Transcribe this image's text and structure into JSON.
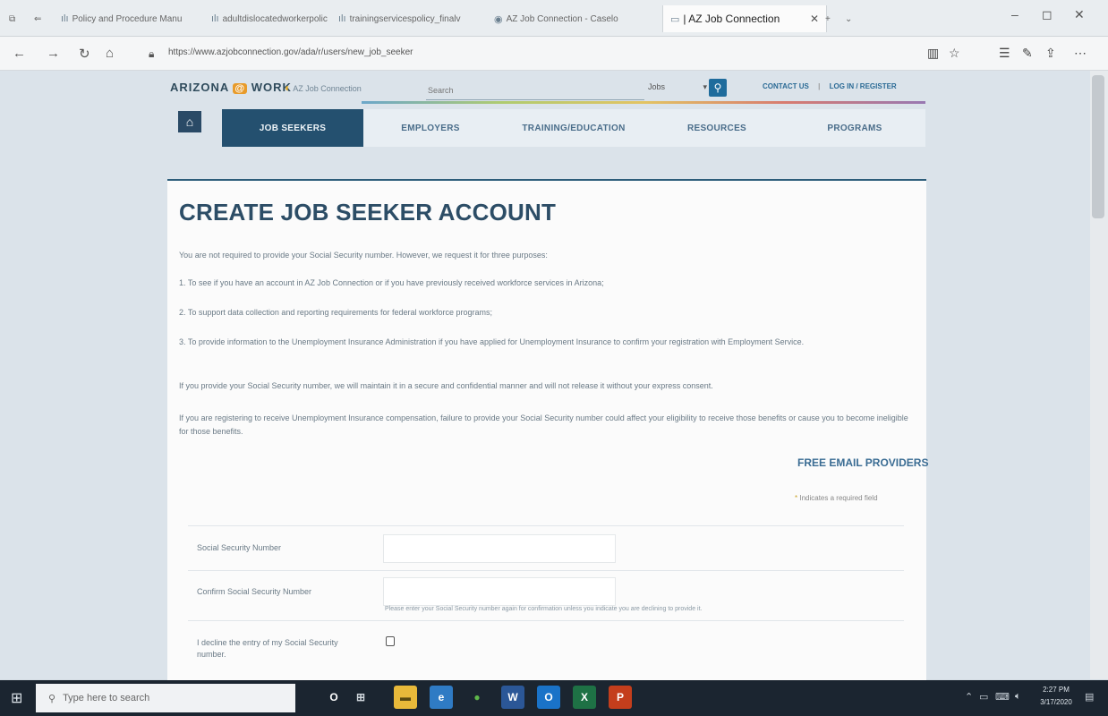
{
  "browser": {
    "tabs": [
      {
        "label": "Policy and Procedure Manu"
      },
      {
        "label": "adultdislocatedworkerpolicy"
      },
      {
        "label": "trainingservicespolicy_finalv"
      },
      {
        "label": "AZ Job Connection - Caselo"
      },
      {
        "label": "| AZ Job Connection",
        "active": true
      }
    ],
    "url": "https://www.azjobconnection.gov/ada/r/users/new_job_seeker",
    "window_controls": {
      "minimize": "–",
      "maximize": "◻",
      "close": "✕"
    }
  },
  "site": {
    "brand": "ARIZONA",
    "brand_e": "@",
    "brand_work": "WORK",
    "az_logo": "AZ Job Connection",
    "search": {
      "placeholder": "Search",
      "value": "Search",
      "scope": "Jobs"
    },
    "search_button": "🔍",
    "contact": "CONTACT US",
    "separator": "|",
    "login": "LOG IN / REGISTER",
    "nav": [
      {
        "label": "JOB SEEKERS",
        "active": true
      },
      {
        "label": "EMPLOYERS"
      },
      {
        "label": "TRAINING/EDUCATION"
      },
      {
        "label": "RESOURCES"
      },
      {
        "label": "PROGRAMS"
      }
    ]
  },
  "page": {
    "title": "CREATE JOB SEEKER ACCOUNT",
    "intro": "You are not required to provide your Social Security number. However, we request it for three purposes:",
    "purpose_1": "1. To see if you have an account in AZ Job Connection or if you have previously received workforce services in Arizona;",
    "purpose_2": "2. To support data collection and reporting requirements for federal workforce programs;",
    "purpose_3": "3. To provide information to the Unemployment Insurance Administration if you have applied for Unemployment Insurance to confirm your registration with Employment Service.",
    "privacy": "If you provide your Social Security number, we will maintain it in a secure and confidential manner and will not release it without your express consent.",
    "ui_note": "If you are registering to receive Unemployment Insurance compensation, failure to provide your Social Security number could affect your eligibility to receive those benefits or cause you to become ineligible for those benefits.",
    "free_email": "FREE EMAIL PROVIDERS",
    "required_star": "*",
    "required_note": "Indicates a required field",
    "form": {
      "ssn_label": "Social Security Number",
      "ssn_value": "",
      "confirm_label": "Confirm Social Security Number",
      "confirm_value": "",
      "confirm_hint": "Please enter your Social Security number again for confirmation unless you indicate you are declining to provide it.",
      "decline_label": "I decline the entry of my Social Security number."
    }
  },
  "taskbar": {
    "search_placeholder": "Type here to search",
    "time": "2:27 PM",
    "date": "3/17/2020",
    "apps": [
      {
        "icon": "cortana-icon",
        "label": "O"
      },
      {
        "icon": "task-view-icon",
        "label": "⊞"
      },
      {
        "icon": "file-explorer-icon",
        "label": "▬"
      },
      {
        "icon": "edge-icon",
        "label": "e"
      },
      {
        "icon": "chrome-icon",
        "label": "●"
      },
      {
        "icon": "word-icon",
        "label": "W"
      },
      {
        "icon": "outlook-icon",
        "label": "O"
      },
      {
        "icon": "excel-icon",
        "label": "X"
      },
      {
        "icon": "powerpoint-icon",
        "label": "P"
      }
    ]
  },
  "colors": {
    "accent": "#24506f",
    "title": "#2c4d66",
    "link": "#3a6c93",
    "search_button": "#1f6c9c"
  }
}
